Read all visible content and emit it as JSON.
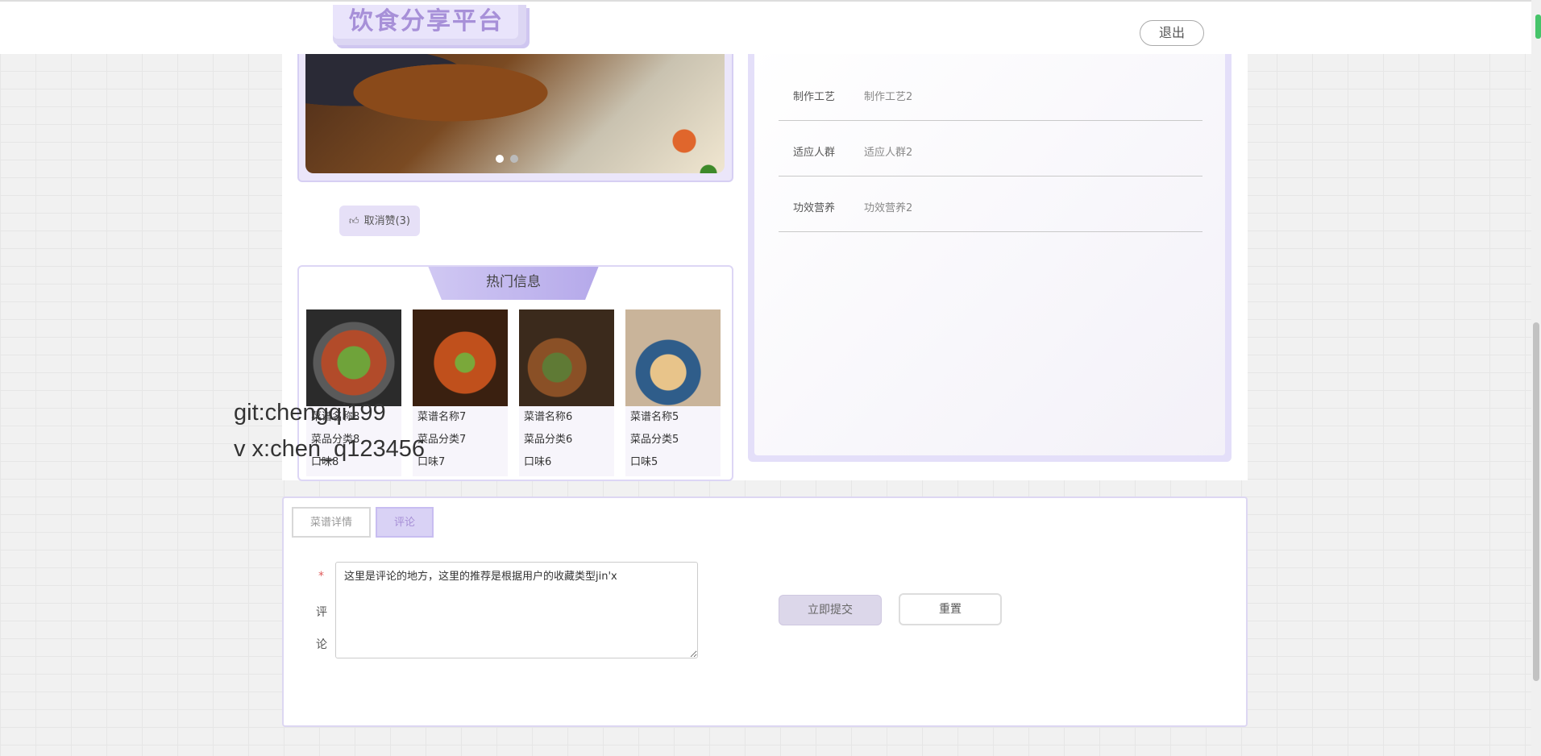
{
  "header": {
    "logo_text": "饮食分享平台",
    "logout_label": "退出"
  },
  "actions": {
    "like_label": "取消赞(3)"
  },
  "hot": {
    "title": "热门信息",
    "items": [
      {
        "name": "菜谱名称8",
        "category": "菜品分类8",
        "taste": "口味8"
      },
      {
        "name": "菜谱名称7",
        "category": "菜品分类7",
        "taste": "口味7"
      },
      {
        "name": "菜谱名称6",
        "category": "菜品分类6",
        "taste": "口味6"
      },
      {
        "name": "菜谱名称5",
        "category": "菜品分类5",
        "taste": "口味5"
      }
    ]
  },
  "details": [
    {
      "key": "制作工艺",
      "value": "制作工艺2"
    },
    {
      "key": "适应人群",
      "value": "适应人群2"
    },
    {
      "key": "功效营养",
      "value": "功效营养2"
    }
  ],
  "watermark": {
    "line1": "git:chengqi199",
    "line2": "v x:chen_q123456"
  },
  "tabs": {
    "detail": "菜谱详情",
    "comment": "评论"
  },
  "form": {
    "required_mark": "*",
    "label_char1": "评",
    "label_char2": "论",
    "comment_value": "这里是评论的地方，这里的推荐是根据用户的收藏类型jin'x",
    "submit_label": "立即提交",
    "reset_label": "重置"
  }
}
